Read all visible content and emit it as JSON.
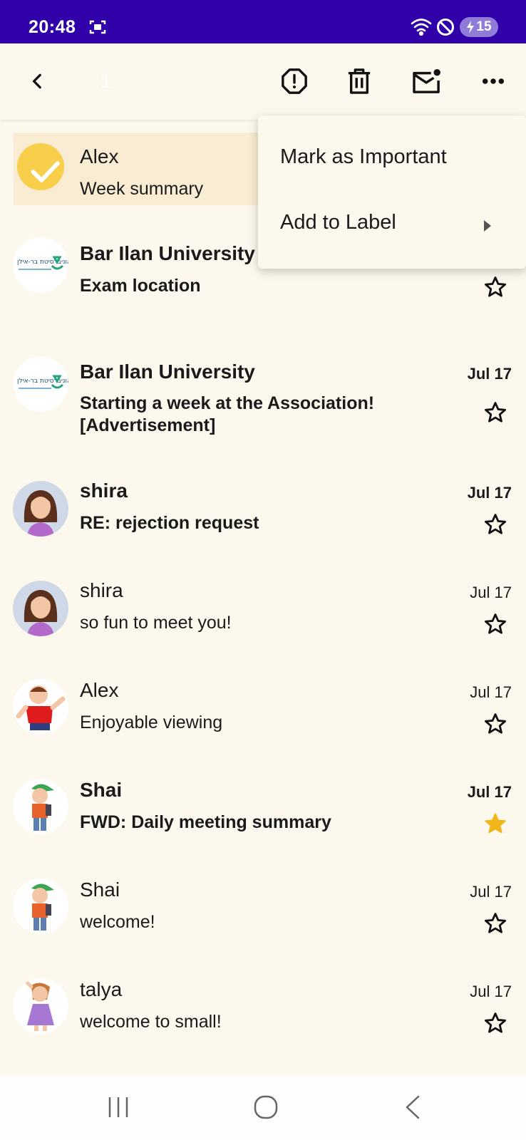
{
  "status_bar": {
    "time": "20:48",
    "battery": "15"
  },
  "app_bar": {
    "selected_count": "1"
  },
  "menu": {
    "items": [
      {
        "label": "Mark as Important"
      },
      {
        "label": "Add to Label"
      }
    ]
  },
  "emails": [
    {
      "sender": "Alex",
      "subject": "Week summary",
      "date": "",
      "unread": false,
      "starred": false,
      "selected": true
    },
    {
      "sender": "Bar Ilan University",
      "subject": "Exam location",
      "date": "",
      "unread": true,
      "starred": false,
      "selected": false
    },
    {
      "sender": "Bar Ilan University",
      "subject": "Starting a week at the Association! [Advertisement]",
      "date": "Jul 17",
      "unread": true,
      "starred": false,
      "selected": false
    },
    {
      "sender": "shira",
      "subject": "RE: rejection request",
      "date": "Jul 17",
      "unread": true,
      "starred": false,
      "selected": false
    },
    {
      "sender": "shira",
      "subject": "so fun to meet you!",
      "date": "Jul 17",
      "unread": false,
      "starred": false,
      "selected": false
    },
    {
      "sender": "Alex",
      "subject": "Enjoyable viewing",
      "date": "Jul 17",
      "unread": false,
      "starred": false,
      "selected": false
    },
    {
      "sender": "Shai",
      "subject": "FWD: Daily meeting summary",
      "date": "Jul 17",
      "unread": true,
      "starred": true,
      "selected": false
    },
    {
      "sender": "Shai",
      "subject": "welcome!",
      "date": "Jul 17",
      "unread": false,
      "starred": false,
      "selected": false
    },
    {
      "sender": "talya",
      "subject": "welcome to small!",
      "date": "Jul 17",
      "unread": false,
      "starred": false,
      "selected": false
    }
  ],
  "avatar_logo_text": "אוניברסיטת בר-אילן",
  "colors": {
    "status_bar": "#3000a8",
    "background": "#fdf8ee",
    "selected_row": "#faecd2",
    "check_circle": "#f7cf4a",
    "star_filled": "#f2b51b"
  }
}
